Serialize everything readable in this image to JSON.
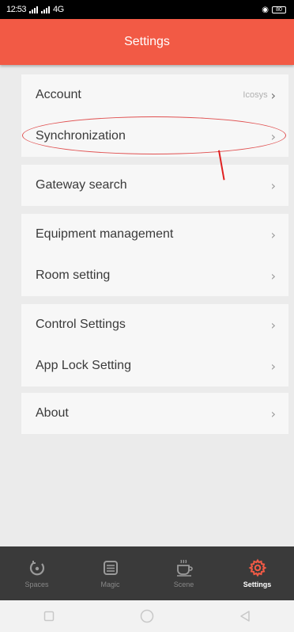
{
  "status_bar": {
    "time": "12:53",
    "network": "4G",
    "battery": "80"
  },
  "header": {
    "title": "Settings"
  },
  "settings_groups": [
    {
      "items": [
        {
          "label": "Account",
          "value": "Icosys"
        },
        {
          "label": "Synchronization"
        }
      ]
    },
    {
      "items": [
        {
          "label": "Gateway search"
        }
      ]
    },
    {
      "items": [
        {
          "label": "Equipment management"
        },
        {
          "label": "Room setting"
        }
      ]
    },
    {
      "items": [
        {
          "label": "Control Settings"
        },
        {
          "label": "App Lock Setting"
        }
      ]
    },
    {
      "items": [
        {
          "label": "About"
        }
      ]
    }
  ],
  "chevron": "›",
  "bottom_nav": [
    {
      "label": "Spaces",
      "icon": "spaces-icon",
      "active": false
    },
    {
      "label": "Magic",
      "icon": "magic-icon",
      "active": false
    },
    {
      "label": "Scene",
      "icon": "scene-icon",
      "active": false
    },
    {
      "label": "Settings",
      "icon": "gear-icon",
      "active": true
    }
  ],
  "colors": {
    "header": "#f25a45",
    "background": "#ebebeb",
    "row_background": "#f7f7f7",
    "bottom_nav": "#3a3a3a",
    "active_icon": "#f25a45"
  }
}
